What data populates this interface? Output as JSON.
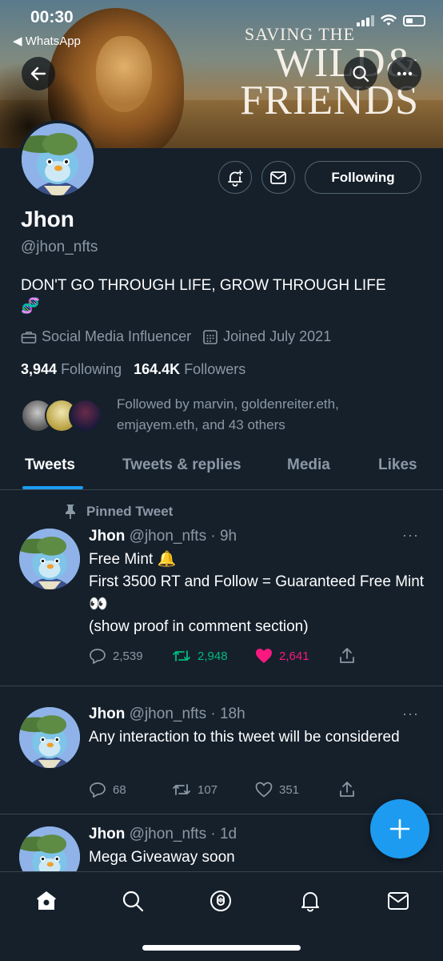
{
  "status_bar": {
    "time": "00:30",
    "back_app": "◀ WhatsApp"
  },
  "banner": {
    "line1": "SAVING THE",
    "line2": "WILD&",
    "line3": "FRIENDS"
  },
  "profile": {
    "name": "Jhon",
    "handle": "@jhon_nfts",
    "bio": "DON'T GO THROUGH LIFE, GROW THROUGH LIFE",
    "bio_emoji": "🧬",
    "category": "Social Media Influencer",
    "joined": "Joined July 2021",
    "following_count": "3,944",
    "following_label": "Following",
    "followers_count": "164.4K",
    "followers_label": "Followers",
    "followed_by": "Followed by marvin, goldenreiter.eth, emjayem.eth, and 43 others",
    "follow_button": "Following"
  },
  "tabs": [
    {
      "label": "Tweets"
    },
    {
      "label": "Tweets & replies"
    },
    {
      "label": "Media"
    },
    {
      "label": "Likes"
    }
  ],
  "pinned_label": "Pinned Tweet",
  "tweets": [
    {
      "name": "Jhon",
      "meta": "@jhon_nfts · 9h",
      "lines": [
        "Free Mint 🔔",
        "First 3500 RT and Follow  = Guaranteed Free Mint 👀",
        "(show proof in comment section)"
      ],
      "replies": "2,539",
      "retweets": "2,948",
      "likes": "2,641"
    },
    {
      "name": "Jhon",
      "meta": "@jhon_nfts · 18h",
      "lines": [
        "Any interaction to this tweet will be considered"
      ],
      "replies": "68",
      "retweets": "107",
      "likes": "351"
    },
    {
      "name": "Jhon",
      "meta": "@jhon_nfts · 1d",
      "lines": [
        "Mega Giveaway soon"
      ]
    }
  ],
  "more_glyph": "···",
  "fab_glyph": "+",
  "colors": {
    "background": "#15202b",
    "accent": "#1d9bf0",
    "retweet": "#00ba7c",
    "like": "#f91880",
    "muted": "#8b98a5"
  }
}
